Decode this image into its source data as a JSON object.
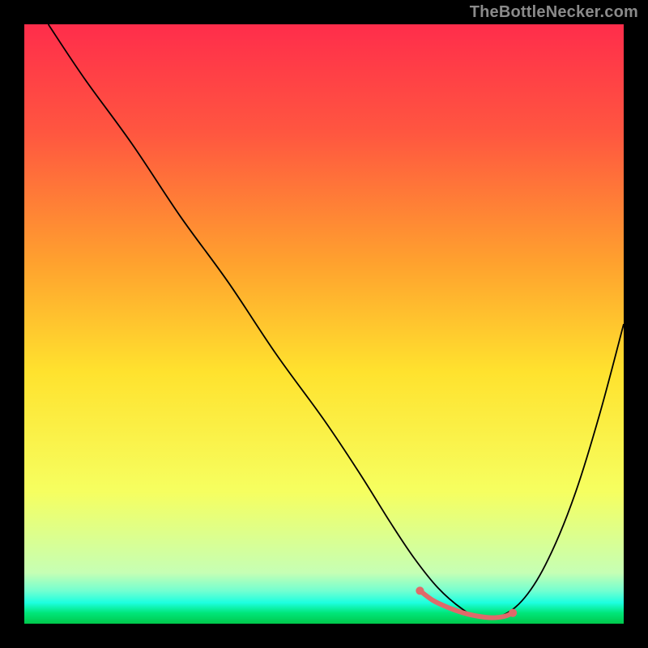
{
  "attribution": "TheBottleNecker.com",
  "chart_data": {
    "type": "line",
    "title": "",
    "xlabel": "",
    "ylabel": "",
    "xlim": [
      0,
      100
    ],
    "ylim": [
      0,
      100
    ],
    "background_gradient": {
      "stops": [
        {
          "offset": 0.0,
          "color": "#ff2d4b"
        },
        {
          "offset": 0.18,
          "color": "#ff5640"
        },
        {
          "offset": 0.4,
          "color": "#ffa22e"
        },
        {
          "offset": 0.58,
          "color": "#ffe22e"
        },
        {
          "offset": 0.78,
          "color": "#f6ff60"
        },
        {
          "offset": 0.915,
          "color": "#c6ffb4"
        },
        {
          "offset": 0.945,
          "color": "#74ffd0"
        },
        {
          "offset": 0.965,
          "color": "#1dffe0"
        },
        {
          "offset": 0.982,
          "color": "#00e67a"
        },
        {
          "offset": 1.0,
          "color": "#00c84b"
        }
      ]
    },
    "series": [
      {
        "name": "bottleneck-curve",
        "stroke": "#000000",
        "stroke_width": 1.8,
        "x": [
          4,
          10,
          18,
          26,
          34,
          42,
          50,
          56,
          61,
          65,
          69,
          73,
          76,
          80,
          84,
          88,
          92,
          96,
          100
        ],
        "y": [
          100,
          91,
          80,
          68,
          57,
          45,
          34,
          25,
          17,
          11,
          6,
          2.5,
          1,
          1.5,
          5,
          12,
          22,
          35,
          50
        ]
      }
    ],
    "highlight": {
      "name": "optimal-range",
      "stroke": "#e06a6a",
      "stroke_width": 6,
      "x": [
        66,
        68,
        70,
        72,
        74,
        76,
        78,
        80,
        81.5
      ],
      "y": [
        5.5,
        4,
        3,
        2.2,
        1.6,
        1.2,
        1.0,
        1.2,
        1.8
      ],
      "endpoints": [
        {
          "x": 66,
          "y": 5.5
        },
        {
          "x": 81.5,
          "y": 1.8
        }
      ]
    }
  }
}
